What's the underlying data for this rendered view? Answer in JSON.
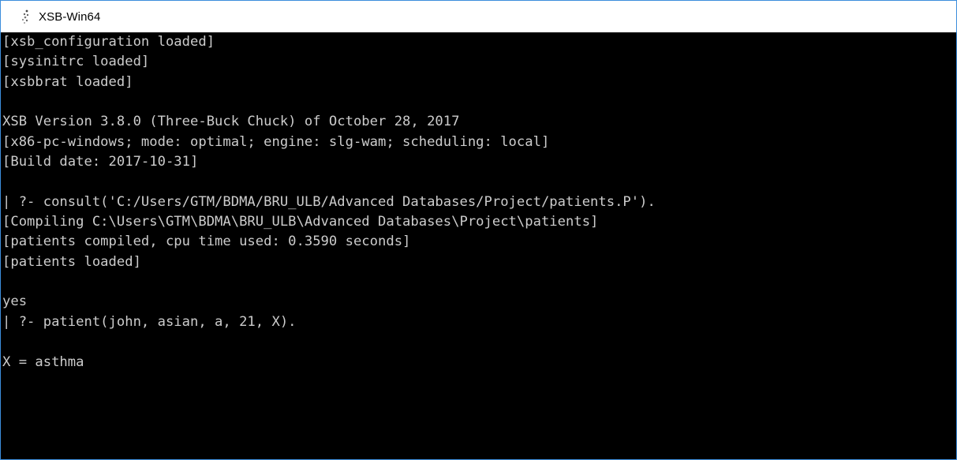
{
  "window": {
    "title": "XSB-Win64",
    "icon": "xsb-app-icon",
    "border_color": "#3c8ddc",
    "background": "#000000",
    "text_color": "#cccccc"
  },
  "console": {
    "lines": [
      "[xsb_configuration loaded]",
      "[sysinitrc loaded]",
      "[xsbbrat loaded]",
      "",
      "XSB Version 3.8.0 (Three-Buck Chuck) of October 28, 2017",
      "[x86-pc-windows; mode: optimal; engine: slg-wam; scheduling: local]",
      "[Build date: 2017-10-31]",
      "",
      "| ?- consult('C:/Users/GTM/BDMA/BRU_ULB/Advanced Databases/Project/patients.P').",
      "[Compiling C:\\Users\\GTM\\BDMA\\BRU_ULB\\Advanced Databases\\Project\\patients]",
      "[patients compiled, cpu time used: 0.3590 seconds]",
      "[patients loaded]",
      "",
      "yes",
      "| ?- patient(john, asian, a, 21, X).",
      "",
      "X = asthma"
    ]
  }
}
